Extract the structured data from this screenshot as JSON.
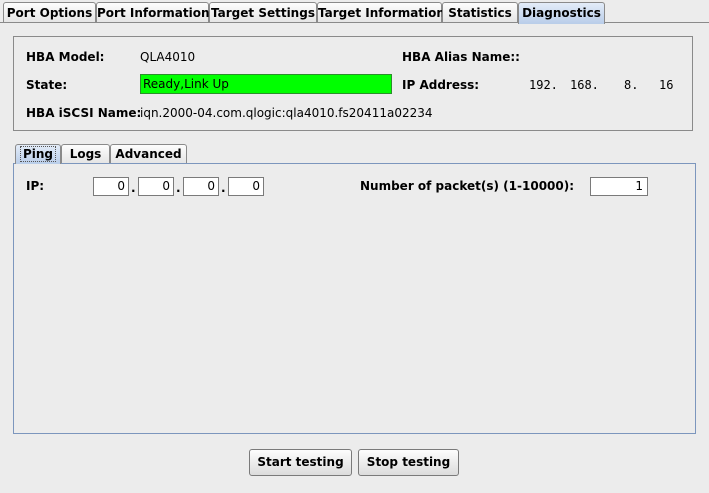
{
  "tabs": [
    "Port Options",
    "Port Information",
    "Target Settings",
    "Target Information",
    "Statistics",
    "Diagnostics"
  ],
  "active_tab": "Diagnostics",
  "info": {
    "hba_model_label": "HBA Model:",
    "hba_model_value": "QLA4010",
    "hba_alias_label": "HBA Alias Name::",
    "hba_alias_value": "",
    "state_label": "State:",
    "state_value": "Ready,Link Up",
    "state_color": "#00ff00",
    "ip_label": "IP Address:",
    "ip_octets": [
      "192.",
      "168.",
      "8.",
      "16"
    ],
    "iscsi_label": "HBA iSCSI Name:",
    "iscsi_value": "iqn.2000-04.com.qlogic:qla4010.fs20411a02234"
  },
  "sub_tabs": [
    "Ping",
    "Logs",
    "Advanced"
  ],
  "active_sub_tab": "Ping",
  "ping": {
    "ip_label": "IP:",
    "ip_octets": [
      "0",
      "0",
      "0",
      "0"
    ],
    "packets_label": "Number of packet(s) (1-10000):",
    "packets_value": "1"
  },
  "buttons": {
    "start": "Start testing",
    "stop": "Stop testing"
  }
}
